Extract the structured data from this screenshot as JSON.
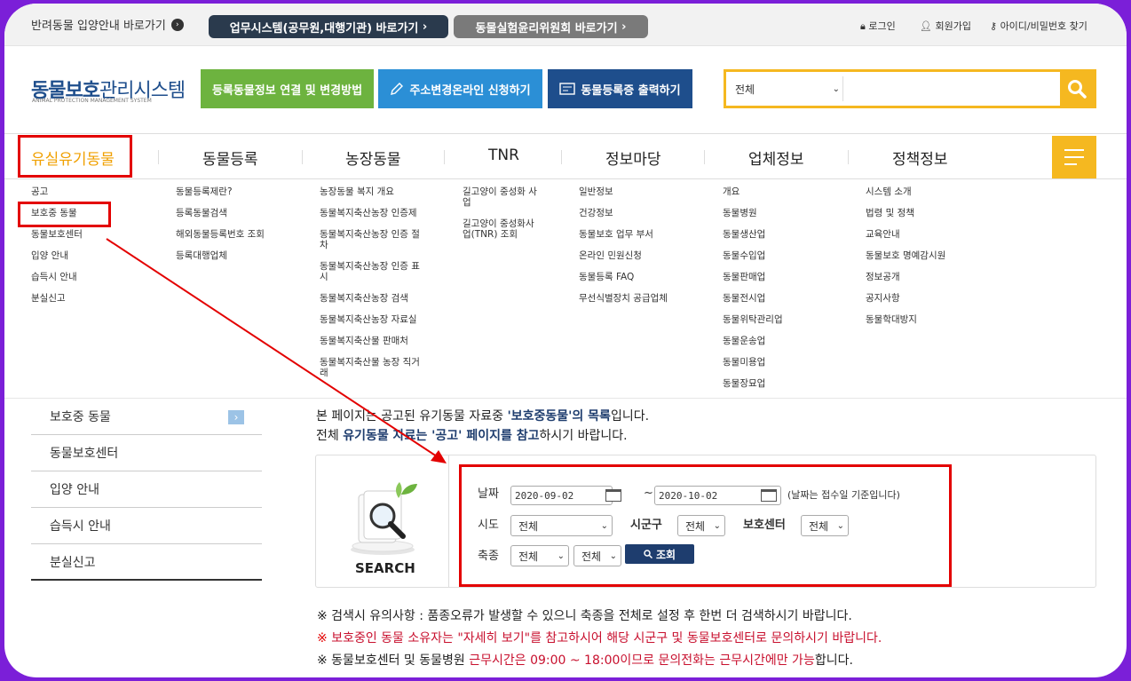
{
  "topbar": {
    "adoption_link": "반려동물 입양안내 바로가기",
    "work_system_btn": "업무시스템(공무원,대행기관) 바로가기",
    "ethics_btn": "동물실험윤리위원회 바로가기",
    "login": "로그인",
    "signup": "회원가입",
    "find": "아이디/비밀번호 찾기"
  },
  "logo": {
    "main_a": "동물보호",
    "main_b": "관리시스템",
    "sub": "ANIMAL PROTECTION MANAGEMENT SYSTEM"
  },
  "header_buttons": {
    "reg_link": "등록동물정보 연결 및 변경방법",
    "address_change": "주소변경온라인 신청하기",
    "print_cert": "동물등록증 출력하기"
  },
  "search": {
    "select_value": "전체",
    "placeholder": ""
  },
  "gnb": [
    "유실유기동물",
    "동물등록",
    "농장동물",
    "TNR",
    "정보마당",
    "업체정보",
    "정책정보"
  ],
  "mega_menu": [
    [
      "공고",
      "보호중 동물",
      "동물보호센터",
      "입양 안내",
      "습득시 안내",
      "분실신고"
    ],
    [
      "동물등록제란?",
      "등록동물검색",
      "해외동물등록번호 조회",
      "등록대행업체"
    ],
    [
      "농장동물 복지 개요",
      "동물복지축산농장 인증제",
      "동물복지축산농장 인증 절차",
      "동물복지축산농장 인증 표시",
      "동물복지축산농장 검색",
      "동물복지축산농장 자료실",
      "동물복지축산물 판매처",
      "동물복지축산물 농장 직거래"
    ],
    [
      "길고양이 중성화 사업",
      "길고양이 중성화사업(TNR) 조회"
    ],
    [
      "일반정보",
      "건강정보",
      "동물보호 업무 부서",
      "온라인 민원신청",
      "동물등록 FAQ",
      "무선식별장치 공급업체"
    ],
    [
      "개요",
      "동물병원",
      "동물생산업",
      "동물수입업",
      "동물판매업",
      "동물전시업",
      "동물위탁관리업",
      "동물운송업",
      "동물미용업",
      "동물장묘업"
    ],
    [
      "시스템 소개",
      "법령 및 정책",
      "교육안내",
      "동물보호 명예감시원",
      "정보공개",
      "공지사항",
      "동물학대방지"
    ]
  ],
  "lnb": [
    "보호중 동물",
    "동물보호센터",
    "입양 안내",
    "습득시 안내",
    "분실신고"
  ],
  "intro": {
    "l1_a": "본 페이지는 공고된 유기동물 자료중 ",
    "l1_b": "'보호중동물'의 목록",
    "l1_c": "입니다.",
    "l2_a": "전체 ",
    "l2_b": "유기동물 자료는 '공고' 페이지를 참고",
    "l2_c": "하시기 바랍니다."
  },
  "search_panel": {
    "search_label": "SEARCH",
    "date_label": "날짜",
    "date_from": "2020-09-02",
    "tilde": "~",
    "date_to": "2020-10-02",
    "date_note": "(날짜는 접수일 기준입니다)",
    "sido_label": "시도",
    "sido_value": "전체",
    "sigungu_label": "시군구",
    "sigungu_value": "전체",
    "center_label": "보호센터",
    "center_value": "전체",
    "species_label": "축종",
    "species_value1": "전체",
    "species_value2": "전체",
    "query_btn": "조회"
  },
  "notes": {
    "n1": "※  검색시 유의사항 : 품종오류가 발생할 수 있으니 축종을 전체로 설정 후 한번 더 검색하시기 바랍니다.",
    "n2_mark": "※ ",
    "n2_text": "보호중인 동물 소유자는 \"자세히 보기\"를 참고하시어 해당 시군구 및 동물보호센터로 문의하시기 바랍니다.",
    "n3_a": "※  동물보호센터 및 동물병원 ",
    "n3_b": "근무시간은 09:00 ~ 18:00이므로 문의전화는 근무시간에만 가능",
    "n3_c": "합니다."
  },
  "colors": {
    "navy": "#1e3d6e",
    "green": "#6db33f",
    "blue": "#2b8fd6",
    "gold": "#f5b820",
    "highlight": "#e30000",
    "frame": "#7b1fd8"
  }
}
